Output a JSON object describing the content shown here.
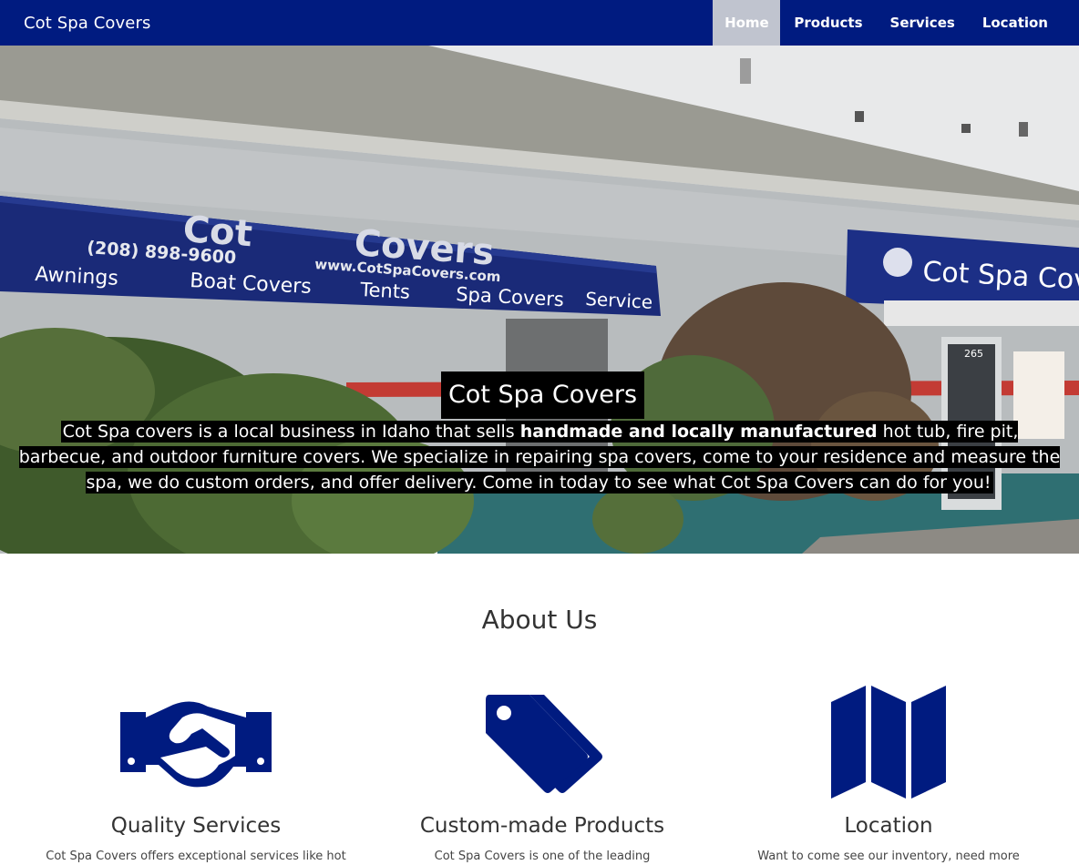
{
  "brand": "Cot Spa Covers",
  "nav": [
    "Home",
    "Products",
    "Services",
    "Location"
  ],
  "hero": {
    "title": "Cot Spa Covers",
    "text_before": "Cot Spa covers is a local business in Idaho that sells ",
    "text_bold": "handmade and locally manufactured",
    "text_after": " hot tub, fire pit, barbecue, and outdoor furniture covers. We specialize in repairing spa covers, come to your residence and measure the spa, we do custom orders, and offer delivery. Come in today to see what Cot Spa Covers can do for you!",
    "awning_main_line1": "Cot",
    "awning_main_line2": "Covers",
    "awning_phone": "(208) 898-9600",
    "awning_web": "www.CotSpaCovers.com",
    "awning_items": [
      "Awnings",
      "Boat Covers",
      "Tents",
      "Spa Covers",
      "Service"
    ],
    "awning_right": "Cot Spa Covers",
    "door_number": "265"
  },
  "about": {
    "title": "About Us",
    "features": [
      {
        "icon": "handshake-icon",
        "title": "Quality Services",
        "text": "Cot Spa Covers offers exceptional services like hot"
      },
      {
        "icon": "tags-icon",
        "title": "Custom-made Products",
        "text": "Cot Spa Covers is one of the leading"
      },
      {
        "icon": "map-icon",
        "title": "Location",
        "text": "Want to come see our inventory, need more"
      }
    ]
  },
  "colors": {
    "nav_bg": "#001b80",
    "icon_blue": "#001b80",
    "active_tab": "#c0c4cf"
  }
}
